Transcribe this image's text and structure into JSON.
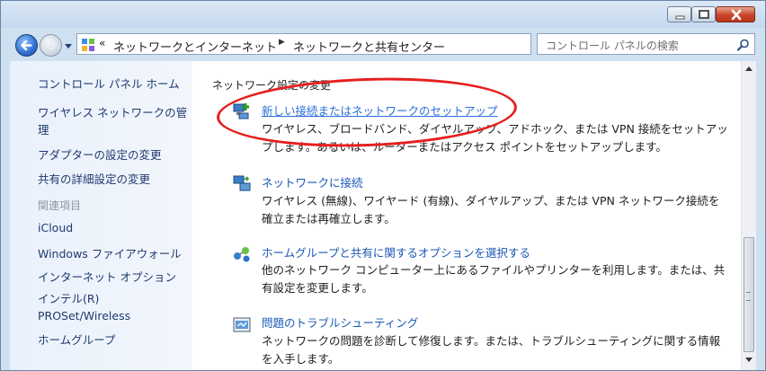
{
  "window": {
    "controls": [
      "minimize-icon",
      "maximize-icon",
      "close-icon"
    ]
  },
  "address": {
    "prefix": "«",
    "crumbs": [
      "ネットワークとインターネット",
      "ネットワークと共有センター"
    ]
  },
  "search": {
    "placeholder": "コントロール パネルの検索"
  },
  "sidebar": {
    "home": "コントロール パネル ホーム",
    "wireless": "ワイヤレス ネットワークの管理",
    "adapter": "アダプターの設定の変更",
    "sharing": "共有の詳細設定の変更",
    "related_header": "関連項目",
    "icloud": "iCloud",
    "firewall": "Windows ファイアウォール",
    "inet_options": "インターネット オプション",
    "intel": "インテル(R) PROSet/Wireless",
    "homegroup": "ホームグループ"
  },
  "main": {
    "section_title": "ネットワーク設定の変更",
    "tasks": [
      {
        "link": "新しい接続またはネットワークのセットアップ",
        "desc": "ワイヤレス、ブロードバンド、ダイヤルアップ、アドホック、または VPN 接続をセットアップします。あるいは、ルーターまたはアクセス ポイントをセットアップします。",
        "icon": "new-connection-icon"
      },
      {
        "link": "ネットワークに接続",
        "desc": "ワイヤレス (無線)、ワイヤード (有線)、ダイヤルアップ、または VPN ネットワーク接続を確立または再確立します。",
        "icon": "connect-network-icon"
      },
      {
        "link": "ホームグループと共有に関するオプションを選択する",
        "desc": "他のネットワーク コンピューター上にあるファイルやプリンターを利用します。または、共有設定を変更します。",
        "icon": "homegroup-icon"
      },
      {
        "link": "問題のトラブルシューティング",
        "desc": "ネットワークの問題を診断して修復します。または、トラブルシューティングに関する情報を入手します。",
        "icon": "troubleshoot-icon"
      }
    ]
  },
  "colors": {
    "link": "#1a57b5",
    "highlight": "#e61e1e",
    "sidebar_bg": "#eaf1fb"
  }
}
